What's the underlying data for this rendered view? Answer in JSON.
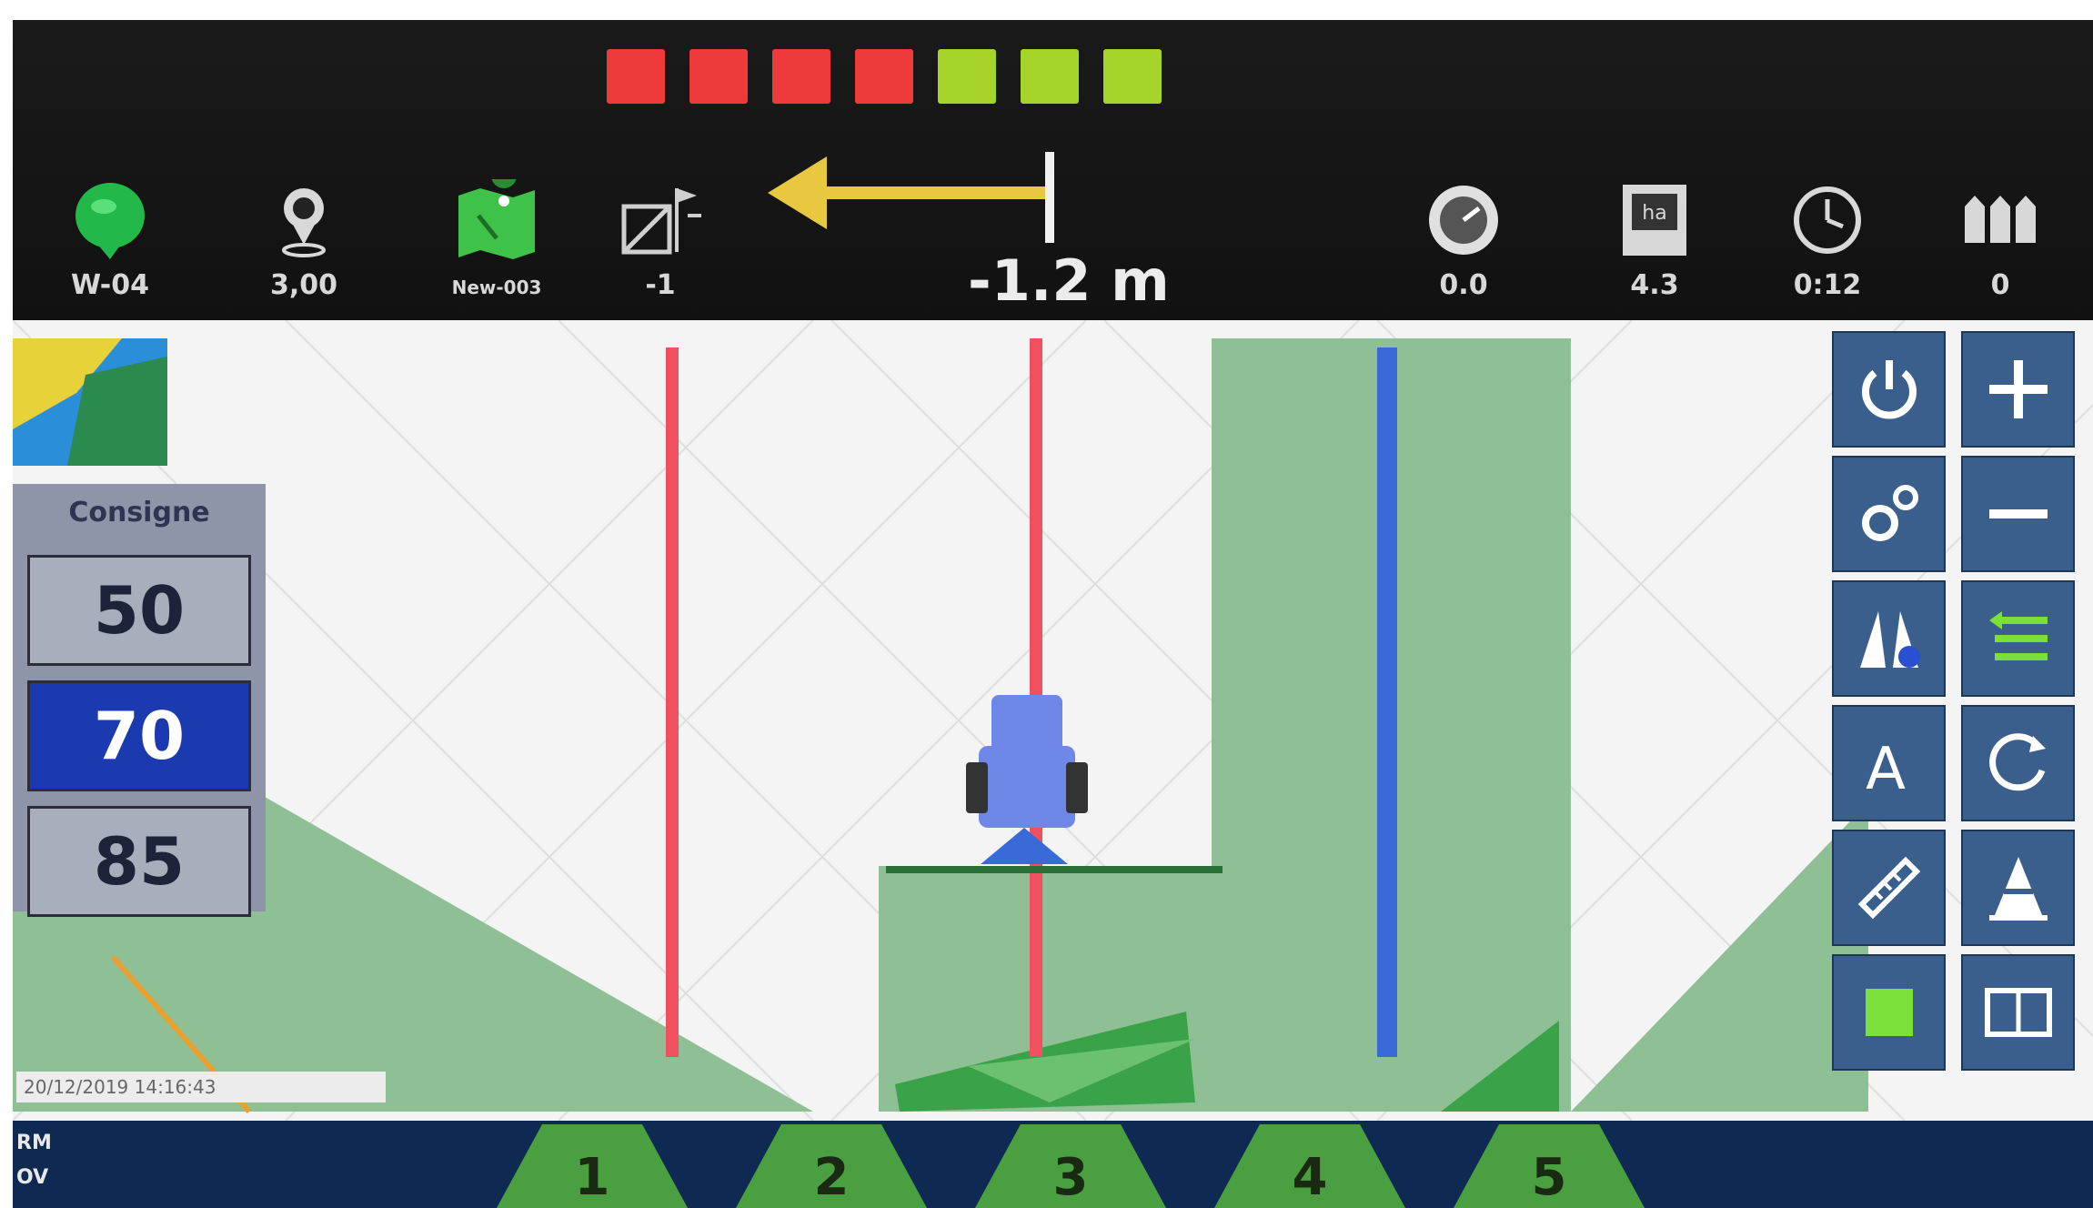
{
  "colors": {
    "light_red": "#ee3a3a",
    "light_green": "#a7d42a",
    "coverage_green": "#8fbf95",
    "guide_red": "#f05060",
    "guide_blue": "#3a6ad8",
    "tool_button": "#3a5f8c",
    "consigne_active": "#1b3ab0",
    "bottom_bar": "#0f2a52"
  },
  "lightbar": {
    "lights": [
      "red",
      "red",
      "red",
      "red",
      "green",
      "green",
      "green"
    ]
  },
  "status_bar": {
    "items": [
      {
        "icon": "satellite-signal-icon",
        "value": "W-04"
      },
      {
        "icon": "gps-pin-icon",
        "value": "3,00"
      },
      {
        "icon": "field-map-icon",
        "value": "New-003"
      },
      {
        "icon": "headland-flag-icon",
        "value": "-1"
      },
      {
        "icon": "speedometer-icon",
        "value": "0.0"
      },
      {
        "icon": "hectare-counter-icon",
        "value": "4.3"
      },
      {
        "icon": "clock-icon",
        "value": "0:12"
      },
      {
        "icon": "sections-icon",
        "value": "0"
      }
    ]
  },
  "guidance": {
    "direction": "left",
    "offset": "-1.2 m"
  },
  "consigne": {
    "title": "Consigne",
    "options": [
      "50",
      "70",
      "85"
    ],
    "selected": "70"
  },
  "map": {
    "timestamp": "20/12/2019 14:16:43",
    "guidance_lines": [
      "red",
      "red",
      "blue"
    ]
  },
  "tools": [
    {
      "icon": "power-icon"
    },
    {
      "icon": "zoom-in-icon"
    },
    {
      "icon": "settings-gears-icon"
    },
    {
      "icon": "zoom-out-icon"
    },
    {
      "icon": "ab-line-icon"
    },
    {
      "icon": "shift-lines-icon"
    },
    {
      "icon": "auto-steer-a-icon"
    },
    {
      "icon": "recenter-ab-icon"
    },
    {
      "icon": "ruler-icon"
    },
    {
      "icon": "cone-icon"
    },
    {
      "icon": "record-square-icon"
    },
    {
      "icon": "book-icon"
    }
  ],
  "bottom_bar": {
    "labels": [
      "RM",
      "OV"
    ],
    "sections": [
      "1",
      "2",
      "3",
      "4",
      "5"
    ]
  }
}
